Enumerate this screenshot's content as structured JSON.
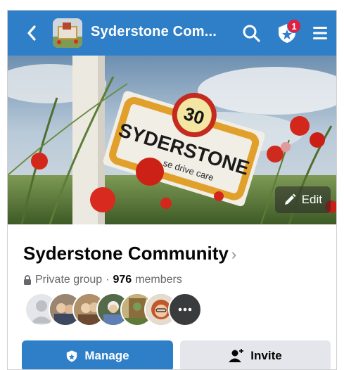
{
  "header": {
    "title": "Syderstone Com...",
    "notification_count": "1",
    "icons": [
      "back-arrow-icon",
      "search-icon",
      "shield-star-icon",
      "menu-icon"
    ]
  },
  "cover": {
    "edit_label": "Edit",
    "sign_speed": "30",
    "sign_text": "SYDERSTONE",
    "sign_subtext": "se drive care"
  },
  "group": {
    "name": "Syderstone Community",
    "privacy": "Private group",
    "member_count": "976",
    "members_label": "members"
  },
  "actions": {
    "manage_label": "Manage",
    "invite_label": "Invite"
  },
  "colors": {
    "brand_blue": "#2f7fc8",
    "badge_red": "#e41e3f",
    "secondary_button": "#e4e6eb"
  }
}
